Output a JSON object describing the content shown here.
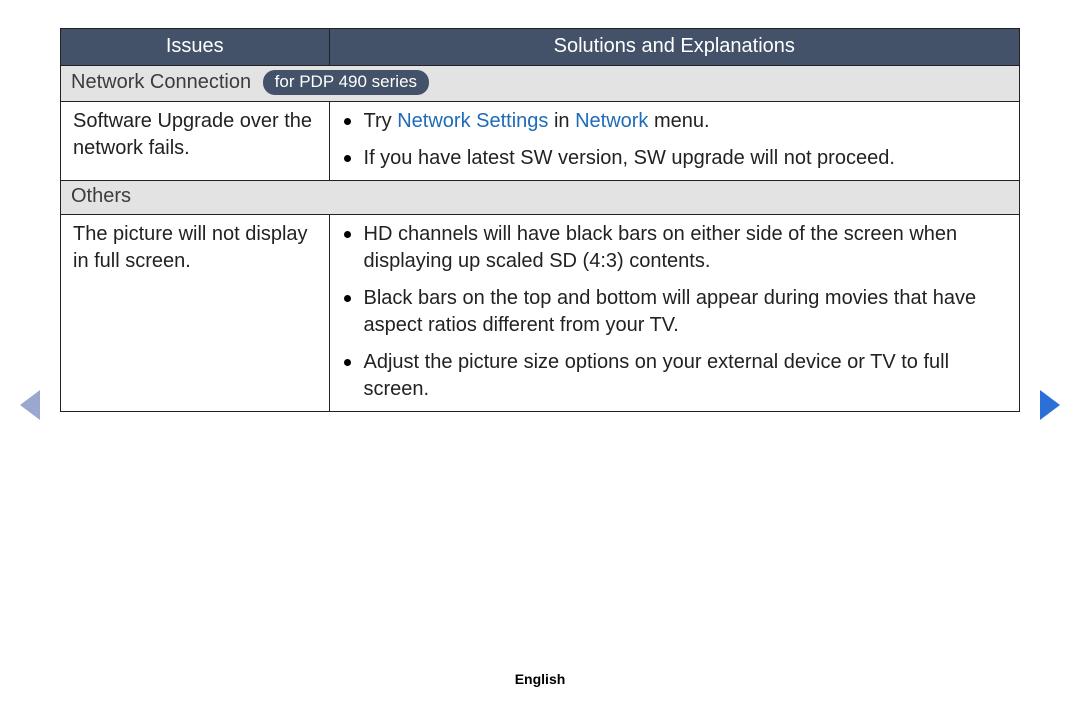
{
  "header": {
    "issues": "Issues",
    "solutions": "Solutions and Explanations"
  },
  "sections": {
    "network": {
      "title": "Network Connection",
      "badge": "for PDP 490 series"
    },
    "others": {
      "title": "Others"
    }
  },
  "rows": {
    "sw": {
      "issue": "Software Upgrade over the network fails.",
      "sol1_pre": "Try ",
      "sol1_hl1": "Network Settings",
      "sol1_mid": " in ",
      "sol1_hl2": "Network",
      "sol1_post": " menu.",
      "sol2": "If you have latest SW version, SW upgrade will not proceed."
    },
    "pic": {
      "issue": "The picture will not display in full screen.",
      "sol1": "HD channels will have black bars on either side of the screen when displaying up scaled SD (4:3) contents.",
      "sol2": "Black bars on the top and bottom will appear during movies that have aspect ratios different from your TV.",
      "sol3": "Adjust the picture size options on your external device or TV to full screen."
    }
  },
  "footer": {
    "lang": "English"
  },
  "colors": {
    "header_bg": "#435169",
    "highlight": "#1e6bb8",
    "arrow_left": "#9aa7cf",
    "arrow_right": "#2c6fd6"
  }
}
